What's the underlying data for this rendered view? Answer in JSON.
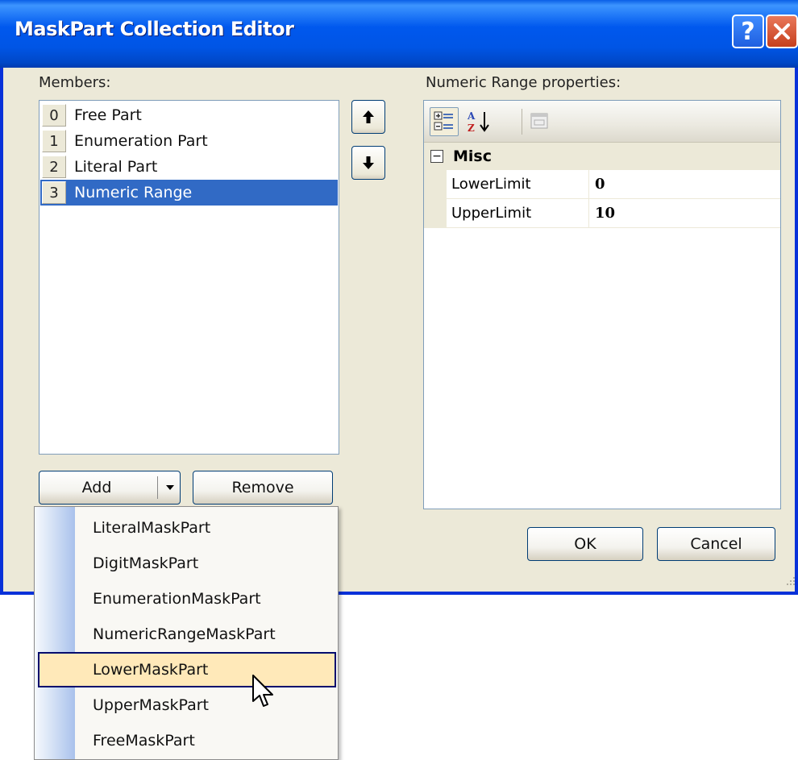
{
  "window": {
    "title": "MaskPart Collection Editor",
    "help_glyph": "?",
    "accent_color": "#0058ee"
  },
  "members": {
    "label": "Members:",
    "items": [
      {
        "index": "0",
        "name": "Free Part"
      },
      {
        "index": "1",
        "name": "Enumeration Part"
      },
      {
        "index": "2",
        "name": "Literal Part"
      },
      {
        "index": "3",
        "name": "Numeric Range",
        "selected": true
      }
    ]
  },
  "properties": {
    "label": "Numeric Range properties:",
    "category": {
      "toggle": "⊟",
      "name": "Misc"
    },
    "rows": [
      {
        "name": "LowerLimit",
        "value": "0"
      },
      {
        "name": "UpperLimit",
        "value": "10"
      }
    ],
    "toolbar_icons": [
      "categorized-icon",
      "alphabetical-icon",
      "property-pages-icon"
    ]
  },
  "buttons": {
    "add": "Add",
    "remove": "Remove",
    "ok": "OK",
    "cancel": "Cancel"
  },
  "add_menu": {
    "items": [
      "LiteralMaskPart",
      "DigitMaskPart",
      "EnumerationMaskPart",
      "NumericRangeMaskPart",
      "LowerMaskPart",
      "UpperMaskPart",
      "FreeMaskPart"
    ],
    "highlighted": "LowerMaskPart"
  }
}
